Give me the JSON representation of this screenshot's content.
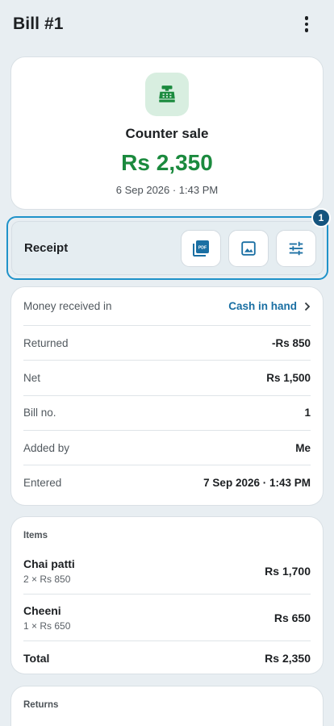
{
  "header": {
    "title": "Bill #1",
    "menu_icon": "more-vertical-icon"
  },
  "summary": {
    "icon": "cash-register-icon",
    "kind": "Counter sale",
    "amount": "Rs 2,350",
    "datetime": "6 Sep 2026 · 1:43 PM",
    "amount_color": "#1b8a3e"
  },
  "receipt": {
    "label": "Receipt",
    "step_badge": "1",
    "actions": [
      {
        "icon": "pdf-icon"
      },
      {
        "icon": "image-icon"
      },
      {
        "icon": "settings-sliders-icon"
      }
    ]
  },
  "details": {
    "money_received_label": "Money received in",
    "money_received_value": "Cash in hand",
    "rows": [
      {
        "label": "Returned",
        "value": "-Rs 850"
      },
      {
        "label": "Net",
        "value": "Rs 1,500"
      },
      {
        "label": "Bill no.",
        "value": "1"
      },
      {
        "label": "Added by",
        "value": "Me"
      },
      {
        "label": "Entered",
        "value": "7 Sep 2026 · 1:43 PM"
      }
    ]
  },
  "items": {
    "header": "Items",
    "list": [
      {
        "name": "Chai patti",
        "qty": "2 × Rs 850",
        "amount": "Rs 1,700"
      },
      {
        "name": "Cheeni",
        "qty": "1 × Rs 650",
        "amount": "Rs 650"
      }
    ],
    "total_label": "Total",
    "total_value": "Rs 2,350"
  },
  "returns": {
    "header": "Returns"
  }
}
